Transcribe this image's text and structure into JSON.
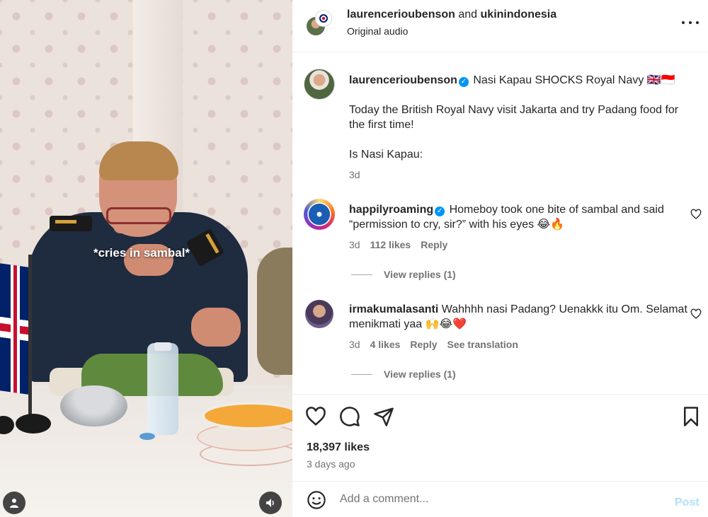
{
  "media": {
    "overlay_caption": "*cries in sambal*"
  },
  "header": {
    "user_a": "laurencerioubenson",
    "and": "and",
    "user_b": "ukinindonesia",
    "subtitle": "Original audio"
  },
  "post_caption": {
    "username": "laurencerioubenson",
    "title": "Nasi Kapau SHOCKS Royal Navy 🇬🇧🇮🇩",
    "line1": "Today the British Royal Navy visit Jakarta and try Padang food for the first time!",
    "line2": "Is Nasi Kapau:",
    "time": "3d"
  },
  "comments": [
    {
      "username": "happilyroaming",
      "verified": true,
      "text": "Homeboy took one bite of sambal and said “permission to cry, sir?” with his eyes 😂🔥",
      "time": "3d",
      "likes": "112 likes",
      "reply": "Reply",
      "view_replies": "View replies (1)"
    },
    {
      "username": "irmakumalasanti",
      "verified": false,
      "text": "Wahhhh nasi Padang? Uenakkk itu Om. Selamat menikmati yaa 🙌😂❤️",
      "time": "3d",
      "likes": "4 likes",
      "reply": "Reply",
      "translation": "See translation",
      "view_replies": "View replies (1)"
    }
  ],
  "stats": {
    "likes": "18,397 likes",
    "time_ago": "3 days ago"
  },
  "composer": {
    "placeholder": "Add a comment...",
    "post_label": "Post"
  },
  "icons": {
    "like": "heart-icon",
    "comment": "comment-icon",
    "share": "share-icon",
    "save": "bookmark-icon",
    "emoji": "emoji-icon",
    "more": "more-icon"
  },
  "colors": {
    "accent": "#0095f6",
    "post_disabled": "#b2dffc",
    "secondary_text": "#737373"
  }
}
